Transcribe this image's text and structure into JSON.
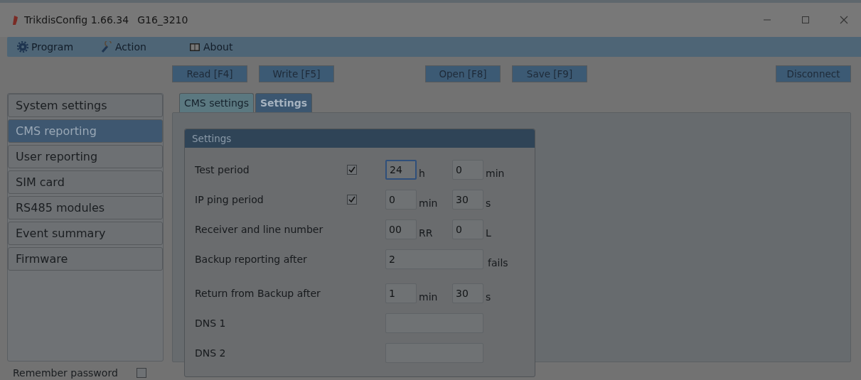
{
  "window": {
    "title": "TrikdisConfig 1.66.34",
    "device": "G16_3210"
  },
  "menu": [
    {
      "label": "Program"
    },
    {
      "label": "Action"
    },
    {
      "label": "About"
    }
  ],
  "toolbar": [
    [
      "Read [F4]",
      "Write [F5]"
    ],
    [
      "Open [F8]",
      "Save [F9]"
    ],
    [
      "Disconnect"
    ]
  ],
  "sidebar": {
    "items": [
      {
        "label": "System settings",
        "selected": false
      },
      {
        "label": "CMS reporting",
        "selected": true
      },
      {
        "label": "User reporting",
        "selected": false
      },
      {
        "label": "SIM card",
        "selected": false
      },
      {
        "label": "RS485 modules",
        "selected": false
      },
      {
        "label": "Event summary",
        "selected": false
      },
      {
        "label": "Firmware",
        "selected": false
      }
    ]
  },
  "remember_password": {
    "label": "Remember password",
    "checked": false
  },
  "tabs": [
    {
      "label": "CMS settings",
      "selected": false
    },
    {
      "label": "Settings",
      "selected": true
    }
  ],
  "group": {
    "title": "Settings",
    "rows": [
      {
        "label": "Test period",
        "kind": "check",
        "checked": true,
        "fields": [
          {
            "value": "24",
            "unit": "h",
            "focused": true
          },
          {
            "value": "0",
            "unit": "min",
            "focused": false
          }
        ]
      },
      {
        "label": "IP ping period",
        "kind": "check",
        "checked": true,
        "fields": [
          {
            "value": "0",
            "unit": "min",
            "focused": false
          },
          {
            "value": "30",
            "unit": "s",
            "focused": false
          }
        ]
      },
      {
        "label": "Receiver and line number",
        "kind": "plain",
        "fields": [
          {
            "value": "00",
            "unit": "RR",
            "focused": false
          },
          {
            "value": "0",
            "unit": "L",
            "focused": false
          }
        ]
      },
      {
        "label": "Backup reporting after",
        "kind": "wide",
        "fields": [
          {
            "value": "2",
            "unit": "fails",
            "focused": false
          }
        ]
      },
      {
        "label": "Return from Backup after",
        "kind": "plain",
        "fields": [
          {
            "value": "1",
            "unit": "min",
            "focused": false
          },
          {
            "value": "30",
            "unit": "s",
            "focused": false
          }
        ]
      },
      {
        "label": "DNS 1",
        "kind": "wide",
        "fields": [
          {
            "focused": false
          }
        ]
      },
      {
        "label": "DNS 2",
        "kind": "wide",
        "fields": [
          {
            "focused": false
          }
        ]
      }
    ]
  }
}
